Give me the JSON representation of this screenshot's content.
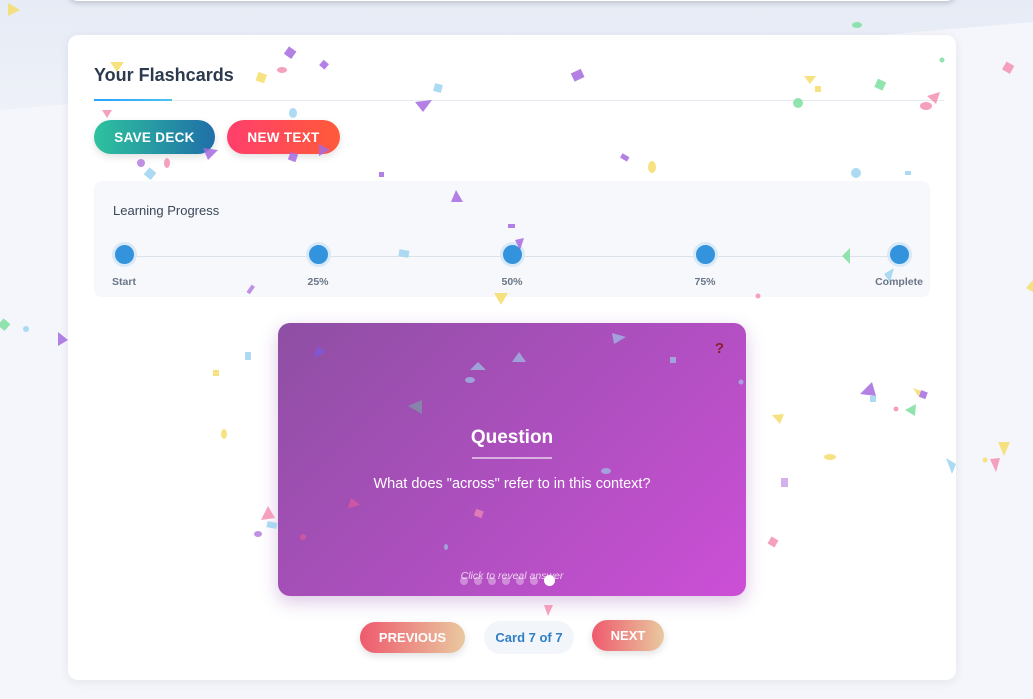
{
  "flashcards": {
    "title": "Your Flashcards",
    "save_label": "SAVE DECK",
    "new_text_label": "NEW TEXT"
  },
  "progress": {
    "title": "Learning Progress",
    "steps": [
      "Start",
      "25%",
      "50%",
      "75%",
      "Complete"
    ]
  },
  "card": {
    "help_icon": "question-mark-icon",
    "heading": "Question",
    "question": "What does \"across\" refer to in this context?",
    "hint": "Click to reveal answer",
    "total_dots": 7,
    "active_dot": 7
  },
  "navigation": {
    "previous_label": "PREVIOUS",
    "next_label": "NEXT",
    "counter": "Card 7 of 7"
  },
  "colors": {
    "accent_blue": "#3493dd",
    "card_gradient_start": "#8e4fa3",
    "card_gradient_end": "#cc4fd6",
    "save_gradient": [
      "#2ec29e",
      "#1f6fa8"
    ],
    "new_gradient": [
      "#ff3f6c",
      "#ff5a3a"
    ]
  }
}
